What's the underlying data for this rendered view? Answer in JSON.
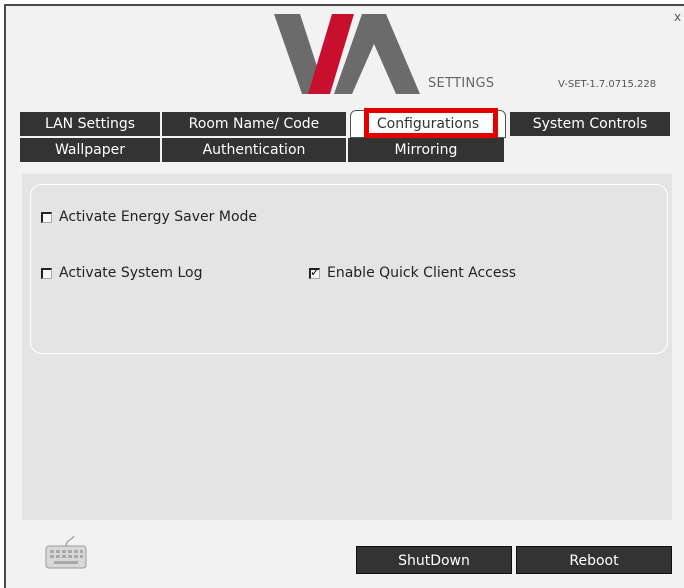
{
  "header": {
    "settings_label": "SETTINGS",
    "version": "V-SET-1.7.0715.228",
    "logo_name": "VIA"
  },
  "window": {
    "close_label": "x"
  },
  "tabs": [
    {
      "label": "LAN Settings",
      "active": false
    },
    {
      "label": "Room Name/ Code",
      "active": false
    },
    {
      "label": "Configurations",
      "active": true
    },
    {
      "label": "System Controls",
      "active": false
    },
    {
      "label": "Wallpaper",
      "active": false
    },
    {
      "label": "Authentication",
      "active": false
    },
    {
      "label": "Mirroring",
      "active": false
    }
  ],
  "options": {
    "energy_saver": {
      "label": "Activate Energy Saver Mode",
      "checked": false
    },
    "system_log": {
      "label": "Activate System Log",
      "checked": false
    },
    "quick_client": {
      "label": "Enable Quick Client Access",
      "checked": true
    }
  },
  "footer": {
    "keyboard_icon": "keyboard-icon",
    "shutdown_label": "ShutDown",
    "reboot_label": "Reboot"
  },
  "colors": {
    "tab_bg": "#333333",
    "highlight": "#e60000",
    "logo_gray": "#6b6b6b",
    "logo_red": "#c8102e",
    "panel_bg": "#e4e4e4"
  }
}
